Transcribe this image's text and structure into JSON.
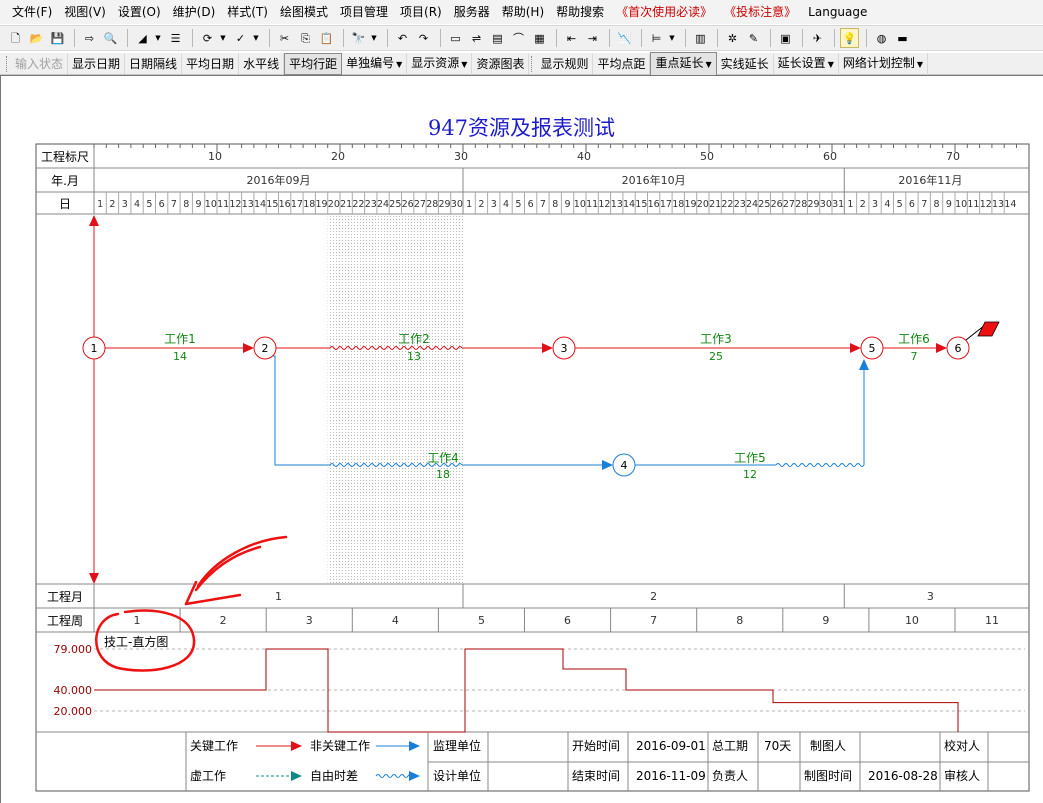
{
  "menu": [
    "文件(F)",
    "视图(V)",
    "设置(O)",
    "维护(D)",
    "样式(T)",
    "绘图模式",
    "项目管理",
    "项目(R)",
    "服务器",
    "帮助(H)",
    "帮助搜索",
    "《首次使用必读》",
    "《投标注意》",
    "Language"
  ],
  "menu_red": [
    false,
    false,
    false,
    false,
    false,
    false,
    false,
    false,
    false,
    false,
    false,
    true,
    true,
    false
  ],
  "toolbar2": [
    "输入状态",
    "显示日期",
    "日期隔线",
    "平均日期",
    "水平线",
    "平均行距",
    "单独编号",
    "显示资源",
    "资源图表",
    "显示规则",
    "平均点距",
    "重点延长",
    "实线延长",
    "延长设置",
    "网络计划控制"
  ],
  "toolbar2_dropdown": [
    false,
    false,
    false,
    false,
    false,
    false,
    true,
    true,
    false,
    false,
    false,
    true,
    false,
    true,
    true
  ],
  "toolbar2_disabled": [
    true,
    false,
    false,
    false,
    false,
    false,
    false,
    false,
    false,
    false,
    false,
    false,
    false,
    false,
    false
  ],
  "toolbar2_pressed": [
    false,
    false,
    false,
    false,
    false,
    true,
    false,
    false,
    false,
    false,
    false,
    true,
    false,
    false,
    false
  ],
  "chart_title": "947资源及报表测试",
  "rows": {
    "ruler_label": "工程标尺",
    "month_label": "年.月",
    "day_label": "日",
    "proj_month_label": "工程月",
    "proj_week_label": "工程周"
  },
  "ruler_ticks": [
    10,
    20,
    30,
    40,
    50,
    60,
    70
  ],
  "months": [
    {
      "label": "2016年09月",
      "days": 30
    },
    {
      "label": "2016年10月",
      "days": 31
    },
    {
      "label": "2016年11月",
      "days": 14
    }
  ],
  "total_days": 75,
  "project_months": [
    {
      "label": "1",
      "start": 0,
      "end": 30
    },
    {
      "label": "2",
      "start": 30,
      "end": 61
    },
    {
      "label": "3",
      "start": 61,
      "end": 75
    }
  ],
  "project_weeks": [
    "1",
    "2",
    "3",
    "4",
    "5",
    "6",
    "7",
    "8",
    "9",
    "10",
    "11"
  ],
  "network": {
    "nodes": [
      {
        "id": "1",
        "day": 0,
        "row": "main",
        "color": "red"
      },
      {
        "id": "2",
        "day": 14,
        "row": "main",
        "color": "red"
      },
      {
        "id": "3",
        "day": 38,
        "row": "main",
        "color": "red"
      },
      {
        "id": "5",
        "day": 63,
        "row": "main",
        "color": "red"
      },
      {
        "id": "6",
        "day": 70,
        "row": "main",
        "color": "red"
      },
      {
        "id": "4",
        "day": 43,
        "row": "low",
        "color": "blue"
      }
    ],
    "tasks": [
      {
        "name": "工作1",
        "duration": "14"
      },
      {
        "name": "工作2",
        "duration": "13"
      },
      {
        "name": "工作3",
        "duration": "25"
      },
      {
        "name": "工作6",
        "duration": "7"
      },
      {
        "name": "工作4",
        "duration": "18"
      },
      {
        "name": "工作5",
        "duration": "12"
      }
    ]
  },
  "histogram": {
    "label": "技工-直方图",
    "y_ticks": [
      "79.000",
      "40.000",
      "20.000"
    ]
  },
  "legend": {
    "critical": "关键工作",
    "noncritical": "非关键工作",
    "dummy": "虚工作",
    "float": "自由时差"
  },
  "info": {
    "supervisor_label": "监理单位",
    "designer_label": "设计单位",
    "start_label": "开始时间",
    "start_value": "2016-09-01",
    "end_label": "结束时间",
    "end_value": "2016-11-09",
    "duration_label": "总工期",
    "duration_value": "70天",
    "owner_label": "负责人",
    "drafter_label": "制图人",
    "draft_time_label": "制图时间",
    "draft_time_value": "2016-08-28",
    "checker_label": "校对人",
    "reviewer_label": "审核人"
  }
}
